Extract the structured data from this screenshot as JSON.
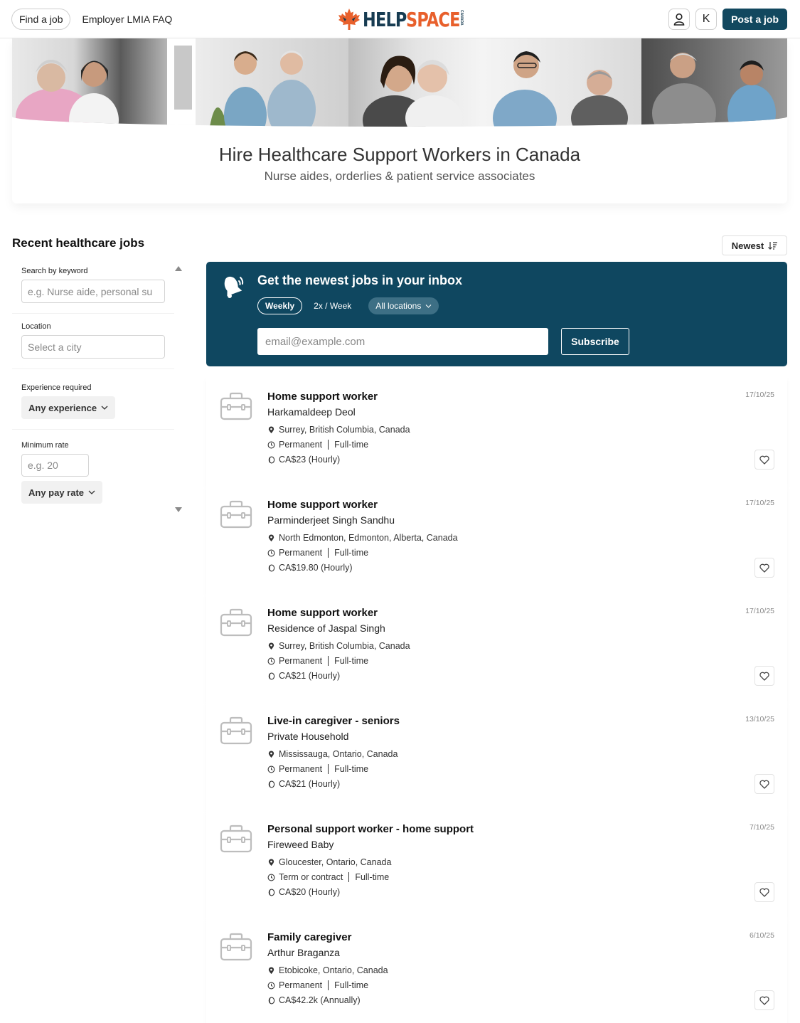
{
  "header": {
    "find_job": "Find a job",
    "employer_faq": "Employer LMIA FAQ",
    "logo_help": "HELP",
    "logo_space": "SPACE",
    "logo_country": "CANADA",
    "avatar_initial": "K",
    "post_job": "Post a job"
  },
  "hero": {
    "title": "Hire Healthcare Support Workers in Canada",
    "subtitle": "Nurse aides, orderlies & patient service associates"
  },
  "list": {
    "section_title": "Recent healthcare jobs",
    "sort_label": "Newest"
  },
  "filters": {
    "keyword_label": "Search by keyword",
    "keyword_placeholder": "e.g. Nurse aide, personal su",
    "location_label": "Location",
    "location_placeholder": "Select a city",
    "experience_label": "Experience required",
    "experience_value": "Any experience",
    "rate_label": "Minimum rate",
    "rate_placeholder": "e.g. 20",
    "pay_value": "Any pay rate"
  },
  "newsletter": {
    "title": "Get the newest jobs in your inbox",
    "freq_weekly": "Weekly",
    "freq_2x": "2x / Week",
    "locations": "All locations",
    "email_placeholder": "email@example.com",
    "subscribe": "Subscribe"
  },
  "jobs": [
    {
      "title": "Home support worker",
      "company": "Harkamaldeep Deol",
      "location": "Surrey, British Columbia, Canada",
      "term": "Permanent",
      "type": "Full-time",
      "pay": "CA$23 (Hourly)",
      "date": "17/10/25"
    },
    {
      "title": "Home support worker",
      "company": "Parminderjeet Singh Sandhu",
      "location": "North Edmonton, Edmonton, Alberta, Canada",
      "term": "Permanent",
      "type": "Full-time",
      "pay": "CA$19.80 (Hourly)",
      "date": "17/10/25"
    },
    {
      "title": "Home support worker",
      "company": "Residence of Jaspal Singh",
      "location": "Surrey, British Columbia, Canada",
      "term": "Permanent",
      "type": "Full-time",
      "pay": "CA$21 (Hourly)",
      "date": "17/10/25"
    },
    {
      "title": "Live-in caregiver - seniors",
      "company": "Private Household",
      "location": "Mississauga, Ontario, Canada",
      "term": "Permanent",
      "type": "Full-time",
      "pay": "CA$21 (Hourly)",
      "date": "13/10/25"
    },
    {
      "title": "Personal support worker - home support",
      "company": "Fireweed Baby",
      "location": "Gloucester, Ontario, Canada",
      "term": "Term or contract",
      "type": "Full-time",
      "pay": "CA$20 (Hourly)",
      "date": "7/10/25"
    },
    {
      "title": "Family caregiver",
      "company": "Arthur Braganza",
      "location": "Etobicoke, Ontario, Canada",
      "term": "Permanent",
      "type": "Full-time",
      "pay": "CA$42.2k (Annually)",
      "date": "6/10/25"
    }
  ],
  "colors": {
    "brand_dark": "#12485f",
    "newsletter_bg": "#0f4760",
    "logo_orange": "#e8602c"
  }
}
